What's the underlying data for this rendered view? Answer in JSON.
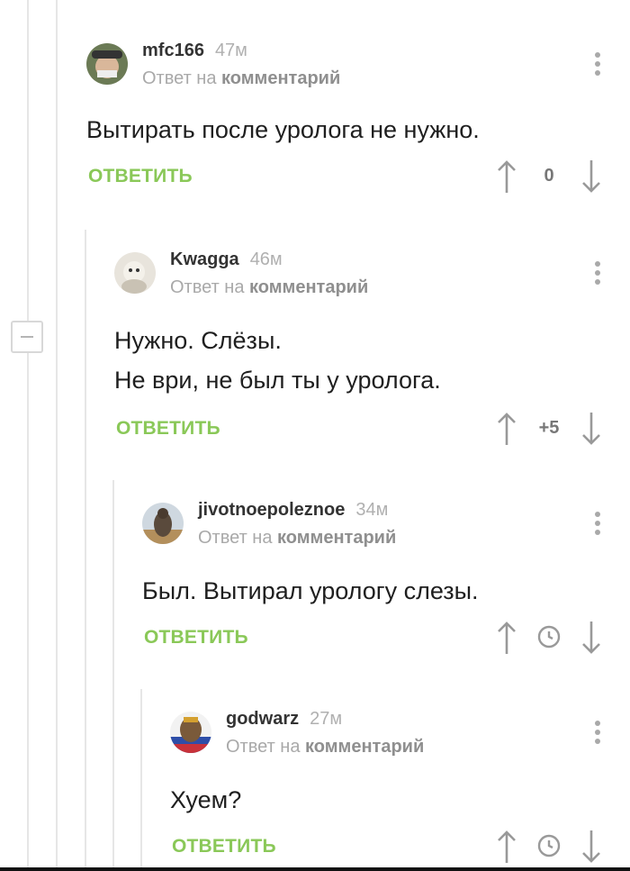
{
  "reply_prefix": "Ответ на",
  "reply_target": "комментарий",
  "reply_label": "ОТВЕТИТЬ",
  "colors": {
    "accent": "#8ac858",
    "muted": "#a9a9a9"
  },
  "comments": [
    {
      "user": "mfc166",
      "time": "47м",
      "lines": [
        "Вытирать после уролога не нужно."
      ],
      "score": "0"
    },
    {
      "user": "Kwagga",
      "time": "46м",
      "lines": [
        "Нужно. Слёзы.",
        "Не ври, не был ты у уролога."
      ],
      "score": "+5"
    },
    {
      "user": "jivotnoepoleznoe",
      "time": "34м",
      "lines": [
        "Был. Вытирал урологу слезы."
      ],
      "score_icon": "clock-icon"
    },
    {
      "user": "godwarz",
      "time": "27м",
      "lines": [
        "Хуем?"
      ],
      "score_icon": "clock-icon"
    }
  ]
}
